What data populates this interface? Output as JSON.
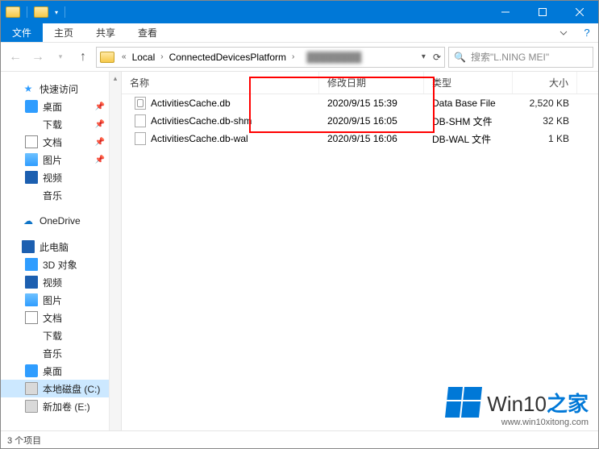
{
  "titlebar": {
    "title": ""
  },
  "ribbon": {
    "file": "文件",
    "tabs": [
      "主页",
      "共享",
      "查看"
    ]
  },
  "breadcrumbs": {
    "items": [
      "Local",
      "ConnectedDevicesPlatform"
    ],
    "tail_hidden": true
  },
  "search": {
    "placeholder": "搜索\"L.NING MEI\""
  },
  "columns": {
    "name": "名称",
    "date": "修改日期",
    "type": "类型",
    "size": "大小"
  },
  "files": [
    {
      "icon": "db",
      "name": "ActivitiesCache.db",
      "date": "2020/9/15 15:39",
      "type": "Data Base File",
      "size": "2,520 KB"
    },
    {
      "icon": "doc",
      "name": "ActivitiesCache.db-shm",
      "date": "2020/9/15 16:05",
      "type": "DB-SHM 文件",
      "size": "32 KB"
    },
    {
      "icon": "doc",
      "name": "ActivitiesCache.db-wal",
      "date": "2020/9/15 16:06",
      "type": "DB-WAL 文件",
      "size": "1 KB"
    }
  ],
  "sidebar": {
    "quick": "快速访问",
    "quick_items": [
      {
        "label": "桌面",
        "icon": "desktop",
        "pinned": true
      },
      {
        "label": "下载",
        "icon": "down",
        "pinned": true
      },
      {
        "label": "文档",
        "icon": "doc",
        "pinned": true
      },
      {
        "label": "图片",
        "icon": "pic",
        "pinned": true
      },
      {
        "label": "视频",
        "icon": "vid",
        "pinned": false
      },
      {
        "label": "音乐",
        "icon": "music",
        "pinned": false
      }
    ],
    "onedrive": "OneDrive",
    "thispc": "此电脑",
    "thispc_items": [
      {
        "label": "3D 对象",
        "icon": "obj3d"
      },
      {
        "label": "视频",
        "icon": "vid"
      },
      {
        "label": "图片",
        "icon": "pic"
      },
      {
        "label": "文档",
        "icon": "doc"
      },
      {
        "label": "下载",
        "icon": "down"
      },
      {
        "label": "音乐",
        "icon": "music"
      },
      {
        "label": "桌面",
        "icon": "desktop"
      },
      {
        "label": "本地磁盘 (C:)",
        "icon": "drive",
        "selected": true
      },
      {
        "label": "新加卷 (E:)",
        "icon": "drive"
      }
    ]
  },
  "statusbar": {
    "count": "3 个项目"
  },
  "watermark": {
    "brand_pre": "Win10",
    "brand_suf": "之家",
    "sub": "www.win10xitong.com"
  }
}
